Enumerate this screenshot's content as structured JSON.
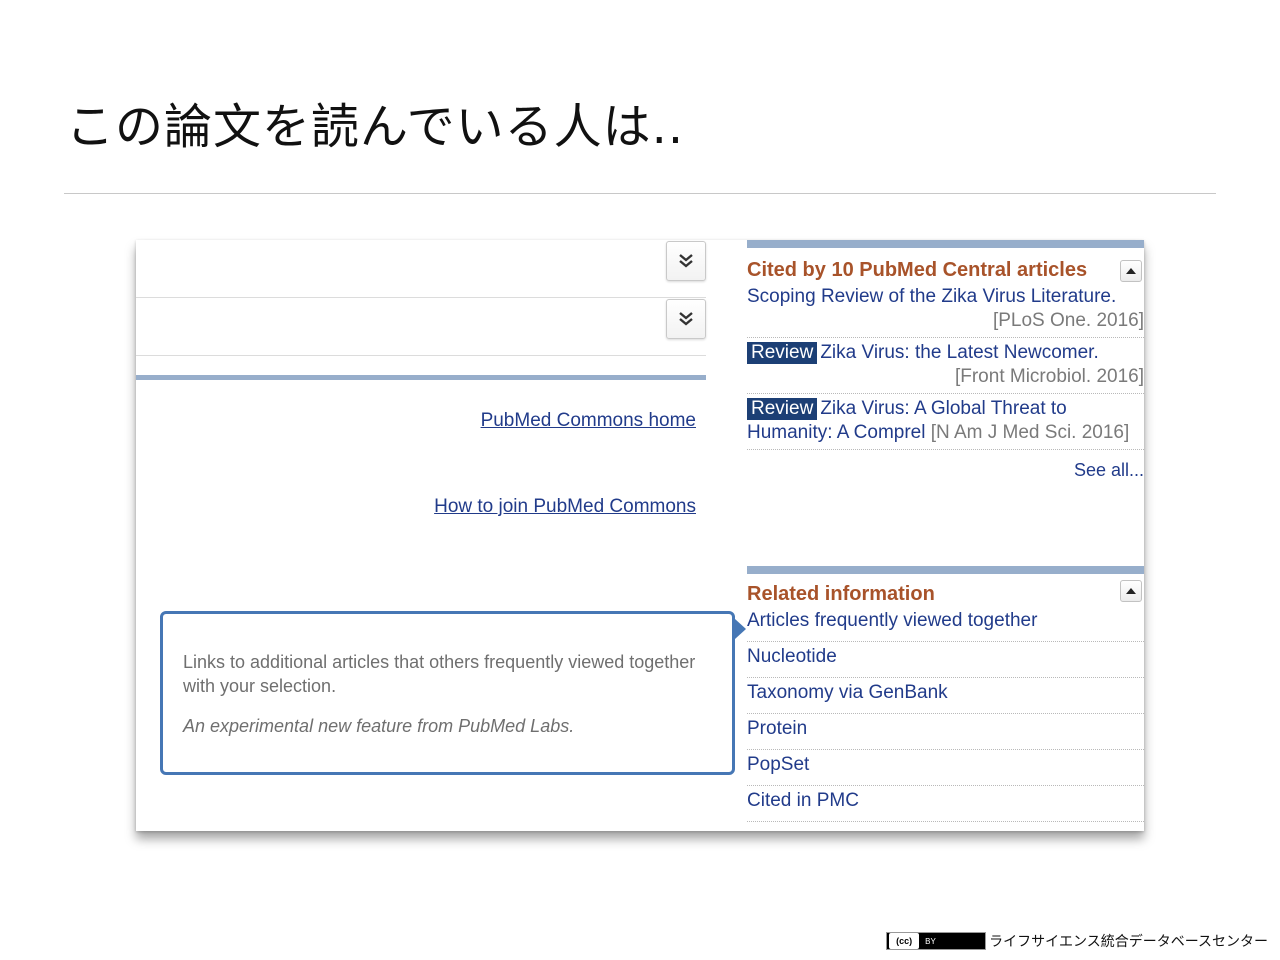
{
  "slide": {
    "title": "この論文を読んでいる人は.."
  },
  "left": {
    "commons_home_link": "PubMed Commons home",
    "commons_join_link": "How to join PubMed Commons",
    "tooltip": {
      "text": "Links to additional articles that others frequently viewed together with your selection.",
      "note": "An experimental new feature from PubMed Labs."
    }
  },
  "cited_by": {
    "title": "Cited by 10 PubMed Central articles",
    "items": [
      {
        "badge": "",
        "title": "Scoping Review of the Zika Virus Literature.",
        "source": "[PLoS One. 2016]"
      },
      {
        "badge": "Review",
        "title": "Zika Virus: the Latest Newcomer.",
        "source": "[Front Microbiol. 2016]"
      },
      {
        "badge": "Review",
        "title": "Zika Virus: A Global Threat to Humanity: A Comprel",
        "source": "[N Am J Med Sci. 2016]"
      }
    ],
    "see_all": "See all..."
  },
  "related": {
    "title": "Related information",
    "items": [
      "Articles frequently viewed together",
      "Nucleotide",
      "Taxonomy via GenBank",
      "Protein",
      "PopSet",
      "Cited in PMC"
    ]
  },
  "footer": {
    "license_cc": "(cc)",
    "license_by": "BY",
    "organization": "ライフサイエンス統合データベースセンター"
  },
  "colors": {
    "portlet_bar": "#97aecb",
    "portlet_title": "#a8532a",
    "link": "#213b8a",
    "review_badge": "#1c3f75",
    "tooltip_border": "#4677b5"
  },
  "icons": {
    "expand": "double-chevron-down-icon",
    "collapse": "caret-up-icon"
  }
}
